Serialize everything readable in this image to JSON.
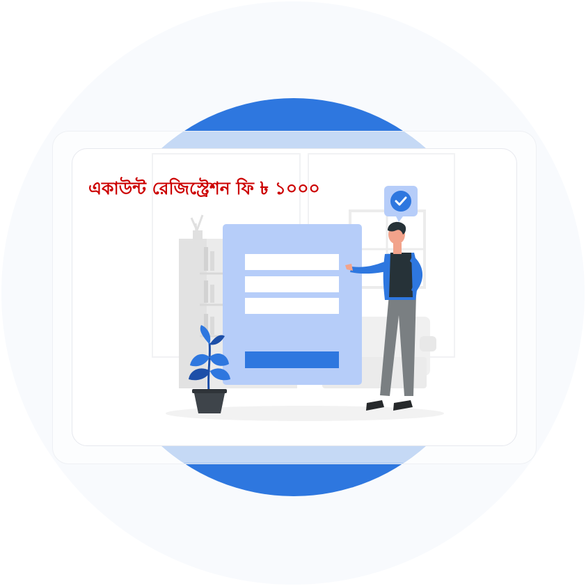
{
  "headline": "একাউন্ট রেজিস্ট্রেশন ফি ৳ ১০০০",
  "colors": {
    "accent_red": "#cc0000",
    "brand_blue": "#2e77df",
    "light_blue": "#b6cdf9",
    "band_blue": "#7eace9"
  },
  "illustration": {
    "subject": "person pointing at a registration form with three input fields and a submit button",
    "icons": [
      "checkmark-speech-bubble-icon",
      "potted-plant",
      "bookshelf",
      "window",
      "couch"
    ]
  }
}
